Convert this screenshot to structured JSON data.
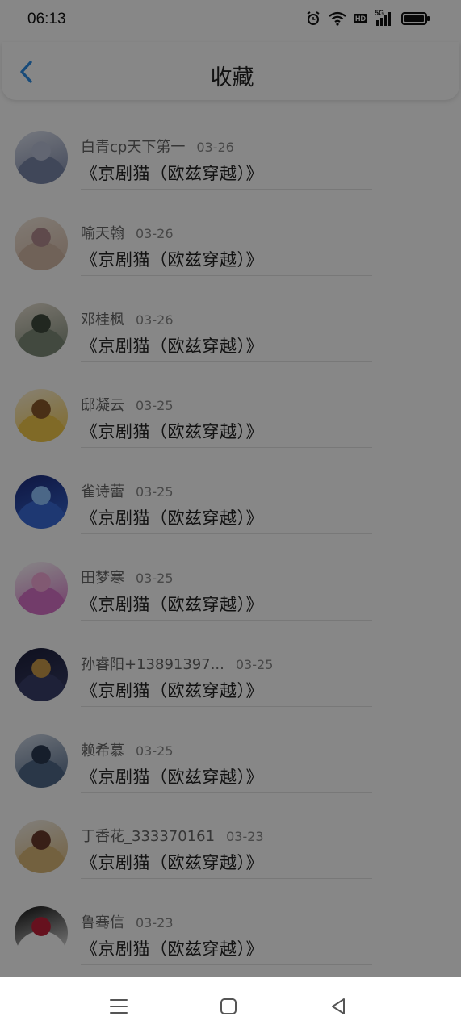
{
  "status_bar": {
    "time": "06:13",
    "hd": "HD",
    "net": "5G",
    "icons": [
      "alarm-icon",
      "wifi-icon",
      "hd-icon",
      "signal-5g-icon",
      "battery-icon"
    ]
  },
  "header": {
    "title": "收藏",
    "back_icon": "chevron-left-icon",
    "accent_color": "#2f8fe6"
  },
  "favorites": [
    {
      "name": "白青cp天下第一",
      "date": "03-26",
      "title": "《京剧猫（欧兹穿越）》",
      "avatar_colors": [
        "#dfe4f0",
        "#7a86a8",
        "#b9c0d8"
      ]
    },
    {
      "name": "喻天翰",
      "date": "03-26",
      "title": "《京剧猫（欧兹穿越）》",
      "avatar_colors": [
        "#f4e8dc",
        "#d4b9a6",
        "#b48d90"
      ]
    },
    {
      "name": "邓桂枫",
      "date": "03-26",
      "title": "《京剧猫（欧兹穿越）》",
      "avatar_colors": [
        "#e8e0d2",
        "#7d8a78",
        "#3f4a3e"
      ]
    },
    {
      "name": "邸凝云",
      "date": "03-25",
      "title": "《京剧猫（欧兹穿越）》",
      "avatar_colors": [
        "#fff3d8",
        "#f2c84a",
        "#8a5a2a"
      ]
    },
    {
      "name": "雀诗蕾",
      "date": "03-25",
      "title": "《京剧猫（欧兹穿越）》",
      "avatar_colors": [
        "#1b2a7a",
        "#3a6bd8",
        "#8ec2ff"
      ]
    },
    {
      "name": "田梦寒",
      "date": "03-25",
      "title": "《京剧猫（欧兹穿越）》",
      "avatar_colors": [
        "#ffffff",
        "#d872c8",
        "#f4a9d8"
      ]
    },
    {
      "name": "孙睿阳+13891397...",
      "date": "03-25",
      "title": "《京剧猫（欧兹穿越）》",
      "avatar_colors": [
        "#1c1f3a",
        "#3a3f6a",
        "#c89a4a"
      ]
    },
    {
      "name": "赖希慕",
      "date": "03-25",
      "title": "《京剧猫（欧兹穿越）》",
      "avatar_colors": [
        "#cfd8e6",
        "#506888",
        "#2b3a52"
      ]
    },
    {
      "name": "丁香花_333370161",
      "date": "03-23",
      "title": "《京剧猫（欧兹穿越）》",
      "avatar_colors": [
        "#f4efe8",
        "#d9b778",
        "#6b3b2c"
      ]
    },
    {
      "name": "鲁骞信",
      "date": "03-23",
      "title": "《京剧猫（欧兹穿越）》",
      "avatar_colors": [
        "#111111",
        "#ffffff",
        "#c0213a"
      ]
    }
  ],
  "nav_bar": {
    "icons": [
      "menu-icon",
      "home-icon",
      "back-triangle-icon"
    ]
  },
  "overlay_color": "rgba(0,0,0,0.47)"
}
